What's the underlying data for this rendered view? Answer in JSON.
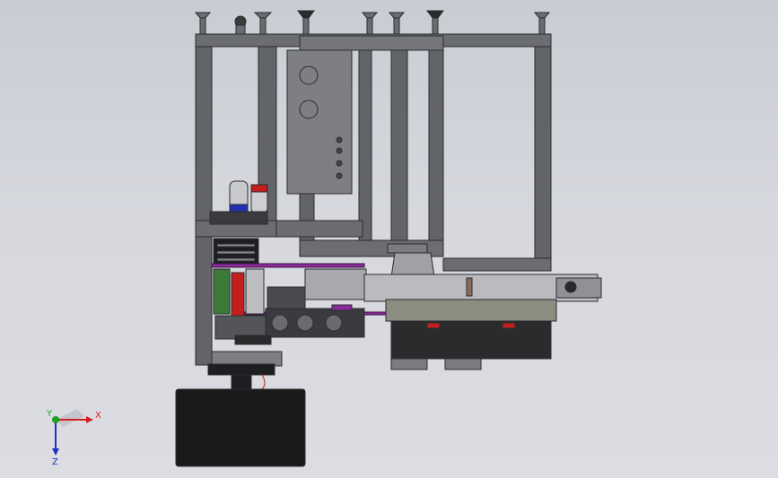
{
  "triad": {
    "x_label": "X",
    "y_label": "Y",
    "z_label": "Z",
    "x_color": "#d22020",
    "y_color": "#20a020",
    "z_color": "#2030c0"
  },
  "colors": {
    "background": "#d4d6dc",
    "frame": "#5e6065",
    "frame_edge": "#2b2c2f",
    "accent_purple": "#8a2b9a",
    "accent_red": "#c41e1e",
    "accent_green": "#3c7a3a",
    "base": "#1a1a1a"
  }
}
